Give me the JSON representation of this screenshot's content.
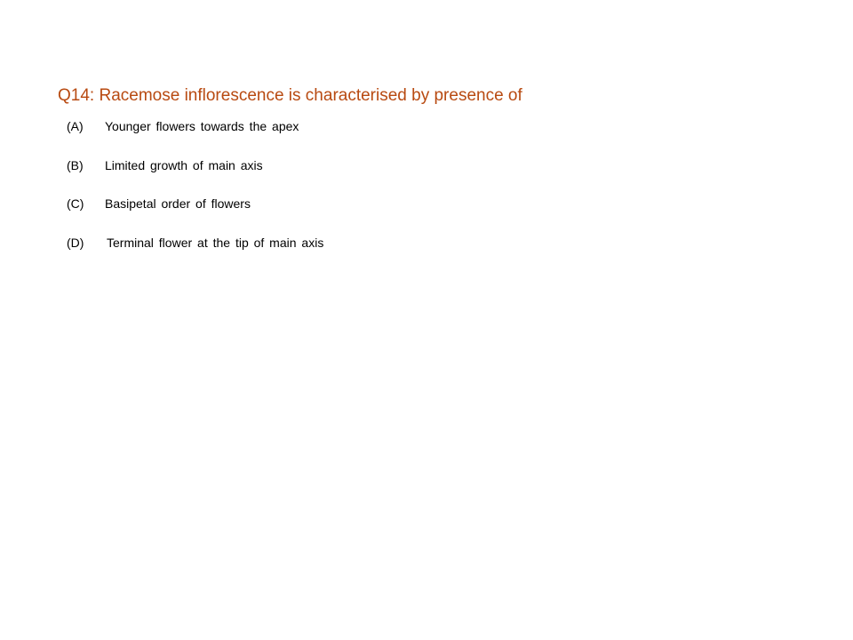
{
  "colors": {
    "question_text": "#b84a11",
    "option_text": "#000000",
    "background": "#ffffff"
  },
  "question": {
    "number": "Q14:",
    "text": "Racemose inflorescence is characterised by presence of"
  },
  "options": [
    {
      "letter": "(A)",
      "text": "Younger flowers towards the apex"
    },
    {
      "letter": "(B)",
      "text": "Limited growth of main axis"
    },
    {
      "letter": "(C)",
      "text": "Basipetal order of flowers"
    },
    {
      "letter": "(D)",
      "text": "Terminal flower at the tip of main axis"
    }
  ]
}
